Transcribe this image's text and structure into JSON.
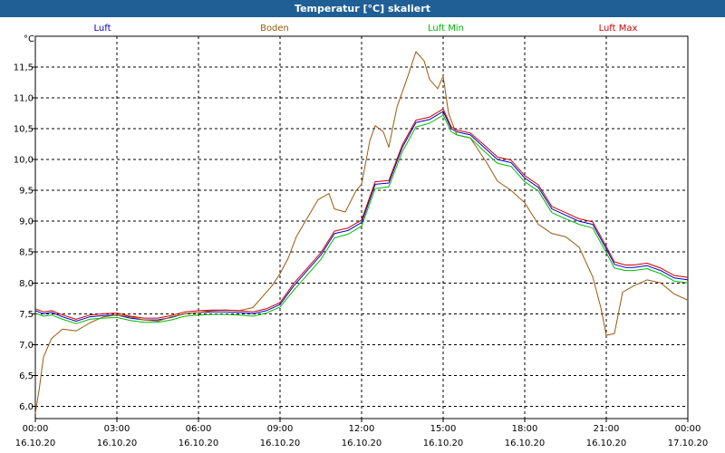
{
  "window": {
    "title": "Temperatur [°C] skaliert"
  },
  "chart_data": {
    "type": "line",
    "unit_label": "°C",
    "grid": true,
    "legend_position": "top",
    "ylim": [
      5.8,
      12.0
    ],
    "yticks": [
      6.0,
      6.5,
      7.0,
      7.5,
      8.0,
      8.5,
      9.0,
      9.5,
      10.0,
      10.5,
      11.0,
      11.5
    ],
    "ytick_labels": [
      "6,0",
      "6,5",
      "7,0",
      "7,5",
      "8,0",
      "8,5",
      "9,0",
      "9,5",
      "10,0",
      "10,5",
      "11,0",
      "11,5"
    ],
    "xlim": [
      0,
      24
    ],
    "xticks": [
      {
        "x": 0,
        "time": "00:00",
        "date": "16.10.20"
      },
      {
        "x": 3,
        "time": "03:00",
        "date": "16.10.20"
      },
      {
        "x": 6,
        "time": "06:00",
        "date": "16.10.20"
      },
      {
        "x": 9,
        "time": "09:00",
        "date": "16.10.20"
      },
      {
        "x": 12,
        "time": "12:00",
        "date": "16.10.20"
      },
      {
        "x": 15,
        "time": "15:00",
        "date": "16.10.20"
      },
      {
        "x": 18,
        "time": "18:00",
        "date": "16.10.20"
      },
      {
        "x": 21,
        "time": "21:00",
        "date": "16.10.20"
      },
      {
        "x": 24,
        "time": "00:00",
        "date": "17.10.20"
      }
    ],
    "series": [
      {
        "name": "Luft",
        "color": "#0000cc",
        "x": [
          0,
          0.3,
          0.6,
          1.0,
          1.5,
          2.0,
          2.5,
          3.0,
          3.5,
          4.0,
          4.5,
          5.0,
          5.5,
          6.0,
          6.5,
          7.0,
          7.5,
          8.0,
          8.5,
          9.0,
          9.5,
          10.0,
          10.5,
          11.0,
          11.5,
          12.0,
          12.5,
          13.0,
          13.5,
          14.0,
          14.5,
          15.0,
          15.3,
          15.5,
          16.0,
          16.5,
          17.0,
          17.5,
          18.0,
          18.5,
          19.0,
          19.5,
          20.0,
          20.5,
          21.0,
          21.3,
          21.7,
          22.0,
          22.5,
          23.0,
          23.5,
          24.0
        ],
        "y": [
          7.55,
          7.5,
          7.52,
          7.45,
          7.38,
          7.45,
          7.47,
          7.48,
          7.43,
          7.4,
          7.4,
          7.44,
          7.5,
          7.52,
          7.53,
          7.53,
          7.52,
          7.5,
          7.55,
          7.65,
          7.95,
          8.2,
          8.45,
          8.8,
          8.85,
          8.98,
          9.6,
          9.62,
          10.2,
          10.6,
          10.65,
          10.78,
          10.5,
          10.45,
          10.4,
          10.2,
          10.0,
          9.95,
          9.7,
          9.55,
          9.2,
          9.1,
          9.0,
          8.95,
          8.55,
          8.3,
          8.25,
          8.25,
          8.28,
          8.2,
          8.08,
          8.05
        ]
      },
      {
        "name": "Boden",
        "color": "#9a5a10",
        "x": [
          0,
          0.15,
          0.3,
          0.6,
          1.0,
          1.5,
          2.0,
          2.5,
          3.0,
          3.5,
          4.0,
          4.5,
          5.0,
          5.5,
          6.0,
          6.5,
          7.0,
          7.5,
          8.0,
          8.3,
          8.7,
          9.0,
          9.3,
          9.6,
          10.0,
          10.4,
          10.8,
          11.0,
          11.4,
          11.8,
          12.0,
          12.3,
          12.5,
          12.8,
          13.0,
          13.3,
          13.7,
          14.0,
          14.3,
          14.5,
          14.8,
          15.0,
          15.2,
          15.5,
          16.0,
          16.3,
          16.6,
          17.0,
          17.5,
          18.0,
          18.5,
          19.0,
          19.5,
          20.0,
          20.5,
          20.8,
          21.0,
          21.3,
          21.6,
          22.0,
          22.5,
          23.0,
          23.5,
          24.0
        ],
        "y": [
          5.88,
          6.3,
          6.8,
          7.1,
          7.25,
          7.22,
          7.35,
          7.45,
          7.48,
          7.45,
          7.4,
          7.38,
          7.45,
          7.5,
          7.52,
          7.55,
          7.56,
          7.55,
          7.6,
          7.75,
          7.95,
          8.15,
          8.4,
          8.75,
          9.05,
          9.35,
          9.45,
          9.2,
          9.15,
          9.5,
          9.6,
          10.3,
          10.55,
          10.45,
          10.2,
          10.85,
          11.35,
          11.75,
          11.6,
          11.3,
          11.15,
          11.35,
          10.75,
          10.4,
          10.35,
          10.15,
          9.95,
          9.65,
          9.5,
          9.3,
          8.95,
          8.8,
          8.75,
          8.58,
          8.1,
          7.6,
          7.15,
          7.18,
          7.85,
          7.95,
          8.05,
          8.0,
          7.82,
          7.72
        ]
      },
      {
        "name": "Luft Min",
        "color": "#00bb00",
        "x": [
          0,
          0.3,
          0.6,
          1.0,
          1.5,
          2.0,
          2.5,
          3.0,
          3.5,
          4.0,
          4.5,
          5.0,
          5.5,
          6.0,
          6.5,
          7.0,
          7.5,
          8.0,
          8.5,
          9.0,
          9.5,
          10.0,
          10.5,
          11.0,
          11.5,
          12.0,
          12.5,
          13.0,
          13.5,
          14.0,
          14.5,
          15.0,
          15.3,
          15.5,
          16.0,
          16.5,
          17.0,
          17.5,
          18.0,
          18.5,
          19.0,
          19.5,
          20.0,
          20.5,
          21.0,
          21.3,
          21.7,
          22.0,
          22.5,
          23.0,
          23.5,
          24.0
        ],
        "y": [
          7.51,
          7.46,
          7.48,
          7.41,
          7.34,
          7.41,
          7.43,
          7.44,
          7.39,
          7.36,
          7.36,
          7.4,
          7.46,
          7.48,
          7.49,
          7.49,
          7.48,
          7.46,
          7.51,
          7.61,
          7.88,
          8.13,
          8.38,
          8.73,
          8.79,
          8.92,
          9.53,
          9.56,
          10.13,
          10.53,
          10.59,
          10.72,
          10.45,
          10.4,
          10.35,
          10.14,
          9.94,
          9.89,
          9.64,
          9.49,
          9.14,
          9.04,
          8.95,
          8.89,
          8.49,
          8.24,
          8.2,
          8.2,
          8.23,
          8.15,
          8.03,
          8.0
        ]
      },
      {
        "name": "Luft Max",
        "color": "#cc0000",
        "x": [
          0,
          0.3,
          0.6,
          1.0,
          1.5,
          2.0,
          2.5,
          3.0,
          3.5,
          4.0,
          4.5,
          5.0,
          5.5,
          6.0,
          6.5,
          7.0,
          7.5,
          8.0,
          8.5,
          9.0,
          9.5,
          10.0,
          10.5,
          11.0,
          11.5,
          12.0,
          12.5,
          13.0,
          13.5,
          14.0,
          14.5,
          15.0,
          15.3,
          15.5,
          16.0,
          16.5,
          17.0,
          17.5,
          18.0,
          18.5,
          19.0,
          19.5,
          20.0,
          20.5,
          21.0,
          21.3,
          21.7,
          22.0,
          22.5,
          23.0,
          23.5,
          24.0
        ],
        "y": [
          7.58,
          7.53,
          7.55,
          7.48,
          7.41,
          7.48,
          7.5,
          7.51,
          7.46,
          7.43,
          7.43,
          7.47,
          7.53,
          7.55,
          7.56,
          7.56,
          7.55,
          7.53,
          7.58,
          7.68,
          7.99,
          8.24,
          8.49,
          8.84,
          8.89,
          9.02,
          9.64,
          9.66,
          10.24,
          10.64,
          10.69,
          10.82,
          10.53,
          10.48,
          10.43,
          10.24,
          10.04,
          9.99,
          9.74,
          9.59,
          9.24,
          9.14,
          9.04,
          8.99,
          8.59,
          8.34,
          8.29,
          8.29,
          8.32,
          8.24,
          8.12,
          8.09
        ]
      }
    ]
  }
}
